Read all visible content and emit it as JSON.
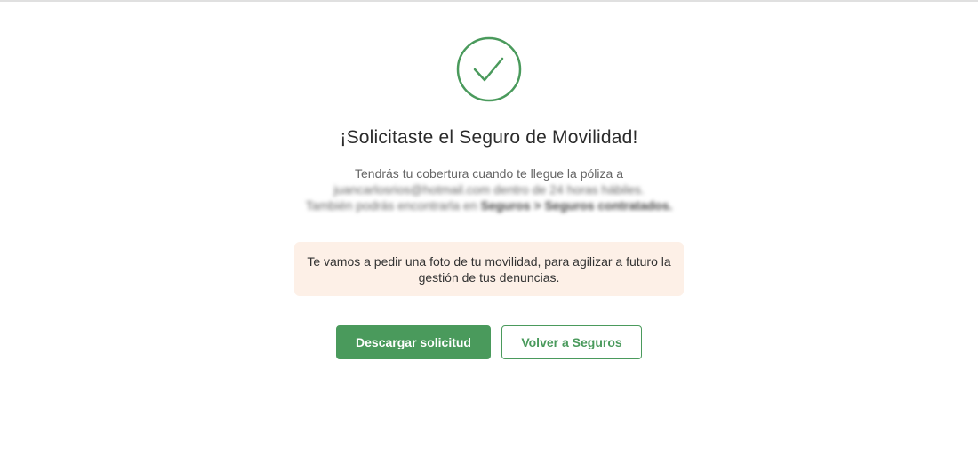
{
  "success": {
    "icon": "check-circle-icon",
    "title": "¡Solicitaste el Seguro de Movilidad!",
    "line1": "Tendrás tu cobertura cuando te llegue la póliza a",
    "line2": "juancarlosrios@hotmail.com dentro de 24 horas hábiles.",
    "line3_prefix": "También podrás encontrarla en ",
    "line3_bold": "Seguros > Seguros contratados."
  },
  "notice": {
    "text": "Te vamos a pedir una foto de tu movilidad, para agilizar a futuro la gestión de tus denuncias."
  },
  "actions": {
    "download_label": "Descargar solicitud",
    "back_label": "Volver a Seguros"
  },
  "colors": {
    "accent": "#4a9a5c",
    "notice_bg": "#fdf0e7"
  }
}
